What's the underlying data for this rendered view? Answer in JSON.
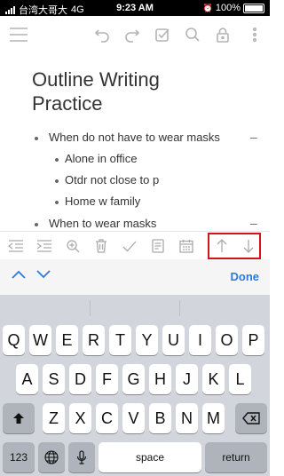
{
  "status_bar": {
    "carrier": "台湾大哥大",
    "network": "4G",
    "time": "9:23 AM",
    "battery": "100%"
  },
  "top_toolbar": {
    "icons": [
      "menu-icon",
      "undo-icon",
      "redo-icon",
      "checkbox-icon",
      "search-icon",
      "lock-icon",
      "more-icon"
    ]
  },
  "document": {
    "title_line1": "Outline Writing",
    "title_line2": "Practice",
    "items": [
      {
        "label": "When do not have to wear masks",
        "level": 1,
        "collapse": "–"
      },
      {
        "label": "Alone in office",
        "level": 2
      },
      {
        "label": "Otdr not close to p",
        "level": 2
      },
      {
        "label": "Home w family",
        "level": 2
      },
      {
        "label": "When to wear masks",
        "level": 1,
        "collapse": "–"
      }
    ]
  },
  "format_toolbar": {
    "icons": [
      "outdent-icon",
      "indent-icon",
      "zoom-in-icon",
      "trash-icon",
      "check-icon",
      "note-icon",
      "calendar-icon",
      "move-up-icon",
      "move-down-icon"
    ],
    "highlight_color": "#d0141a"
  },
  "accessory_bar": {
    "done_label": "Done",
    "accent_color": "#2a7ae2"
  },
  "keyboard": {
    "row1": [
      "Q",
      "W",
      "E",
      "R",
      "T",
      "Y",
      "U",
      "I",
      "O",
      "P"
    ],
    "row2": [
      "A",
      "S",
      "D",
      "F",
      "G",
      "H",
      "J",
      "K",
      "L"
    ],
    "row3": [
      "Z",
      "X",
      "C",
      "V",
      "B",
      "N",
      "M"
    ],
    "numbers_label": "123",
    "space_label": "space",
    "return_label": "return"
  }
}
